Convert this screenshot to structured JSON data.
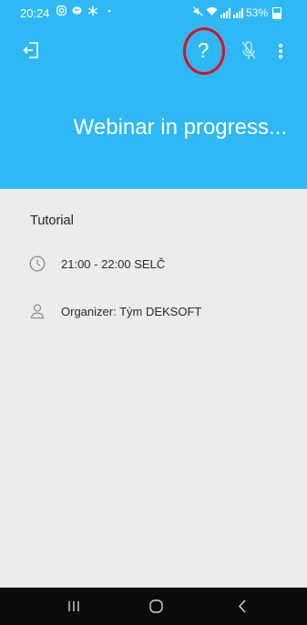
{
  "status_bar": {
    "time": "20:24",
    "battery": "53%"
  },
  "app_bar": {
    "icons": {
      "exit": "exit-icon",
      "help": "?",
      "mic": "mic-off-icon",
      "more": "more-vert-icon"
    }
  },
  "hero": {
    "title": "Webinar in progress..."
  },
  "event": {
    "title": "Tutorial",
    "time": "21:00 - 22:00 SELČ",
    "organizer": "Organizer: Tým DEKSOFT"
  },
  "colors": {
    "primary": "#2eb8f5",
    "highlight_ring": "#e00d1f",
    "content_bg": "#ececec",
    "nav_bg": "#0b0b0b"
  }
}
